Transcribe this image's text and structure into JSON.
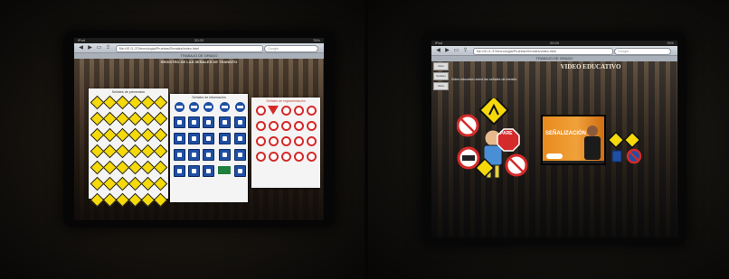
{
  "left_photo": {
    "tablet": {
      "status_left": "iPad",
      "status_time": "20:20",
      "status_right": "76%",
      "url": "file:///E:/1-37/tecnologia/Pruebas/Senales/index.html",
      "search_placeholder": "Google",
      "tab_title": "TRABAJO DE GRADO",
      "page_heading": "REGISTRO DE LAS SEÑALES DE TRANSITO",
      "panels": [
        {
          "title": "Señales de prevención"
        },
        {
          "title": "Señales de información"
        },
        {
          "title": "Señales de reglamentación"
        }
      ]
    }
  },
  "right_photo": {
    "tablet": {
      "status_left": "iPad",
      "status_time": "20:20",
      "status_right": "76%",
      "url": "file:///E:/1-37/tecnologia/Pruebas/Senales/video.html",
      "search_placeholder": "Google",
      "tab_title": "TRABAJO DE GRADO",
      "page_heading": "VIDEO EDUCATIVO",
      "subtitle": "Video educativo sobre las señales de transito",
      "nav_items": [
        "Inicio",
        "Señales",
        "Video"
      ],
      "video_title": "SEÑALIZACIÓN",
      "pare_label": "PARE"
    }
  },
  "colors": {
    "warning_yellow": "#f5d90a",
    "info_blue": "#1f4fa3",
    "regulatory_red": "#d52a2a",
    "video_orange": "#e98a1d"
  }
}
